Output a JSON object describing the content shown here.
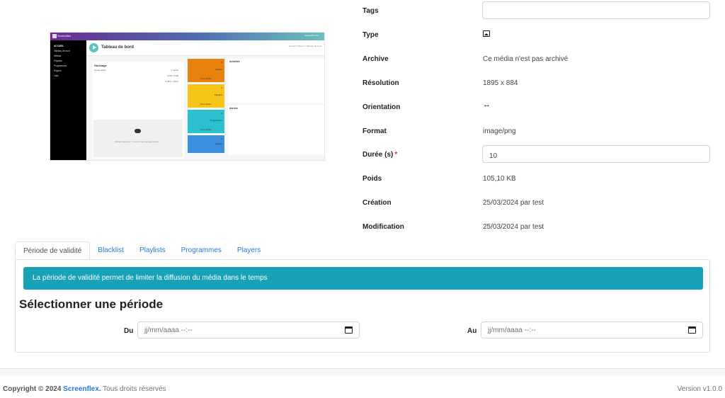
{
  "preview": {
    "brand": "Screenflex",
    "user": "Screenflex test",
    "page_title": "Tableau de bord",
    "breadcrumb": "Accueil / Players / Tableau de bord",
    "sidebar": [
      "Tableau de bord",
      "Médias",
      "Playlists",
      "Programmes",
      "Players",
      "Lists"
    ],
    "sidebar_head": "ACCUEIL",
    "stockage_title": "Stockage",
    "stockage_lines": [
      "Quota utilisé",
      "0 média",
      "0 KB / 0 MB",
      "0,00% / 100%"
    ],
    "upload_text": "Glissez-déposez / importez un nouveau média",
    "cards": [
      {
        "num": "0",
        "label": "Médias",
        "foot": "Plus d'infos",
        "color": "#e8820c"
      },
      {
        "num": "0",
        "label": "Playlists",
        "foot": "Plus d'infos",
        "color": "#f5c518"
      },
      {
        "num": "0",
        "label": "Programmes",
        "foot": "Plus d'infos",
        "color": "#2cc1cf"
      },
      {
        "num": "0",
        "label": "Players",
        "foot": "Plus d'infos",
        "color": "#3a8fe0"
      }
    ],
    "panel_activites": "Activités",
    "panel_alertes": "Alertes"
  },
  "info": {
    "tags_label": "Tags",
    "tags_value": "",
    "type_label": "Type",
    "type_icon": "image-icon",
    "archive_label": "Archive",
    "archive_value": "Ce média n'est pas archivé",
    "resolution_label": "Résolution",
    "resolution_value": "1895 x 884",
    "orientation_label": "Orientation",
    "orientation_icon": "horizontal-arrows-icon",
    "orientation_value": "↔",
    "format_label": "Format",
    "format_value": "image/png",
    "duree_label": "Durée (s)",
    "duree_required": "*",
    "duree_value": "10",
    "poids_label": "Poids",
    "poids_value": "105,10 KB",
    "creation_label": "Création",
    "creation_value": "25/03/2024 par test",
    "modification_label": "Modification",
    "modification_value": "25/03/2024 par test"
  },
  "tabs": [
    {
      "label": "Période de validité",
      "active": true
    },
    {
      "label": "Blacklist",
      "active": false
    },
    {
      "label": "Playlists",
      "active": false
    },
    {
      "label": "Programmes",
      "active": false
    },
    {
      "label": "Players",
      "active": false
    }
  ],
  "validity": {
    "alert": "La période de validité permet de limiter la diffusion du média dans le temps",
    "title": "Sélectionner une période",
    "from_label": "Du",
    "from_placeholder": "jj/mm/aaaa --:--",
    "to_label": "Au",
    "to_placeholder": "jj/mm/aaaa --:--",
    "alert_color": "#17a2b8"
  },
  "footer": {
    "copyright_prefix": "Copyright © 2024",
    "brand": "Screenflex.",
    "rights": "Tous droits réservés",
    "version": "Version v1.0.0"
  }
}
